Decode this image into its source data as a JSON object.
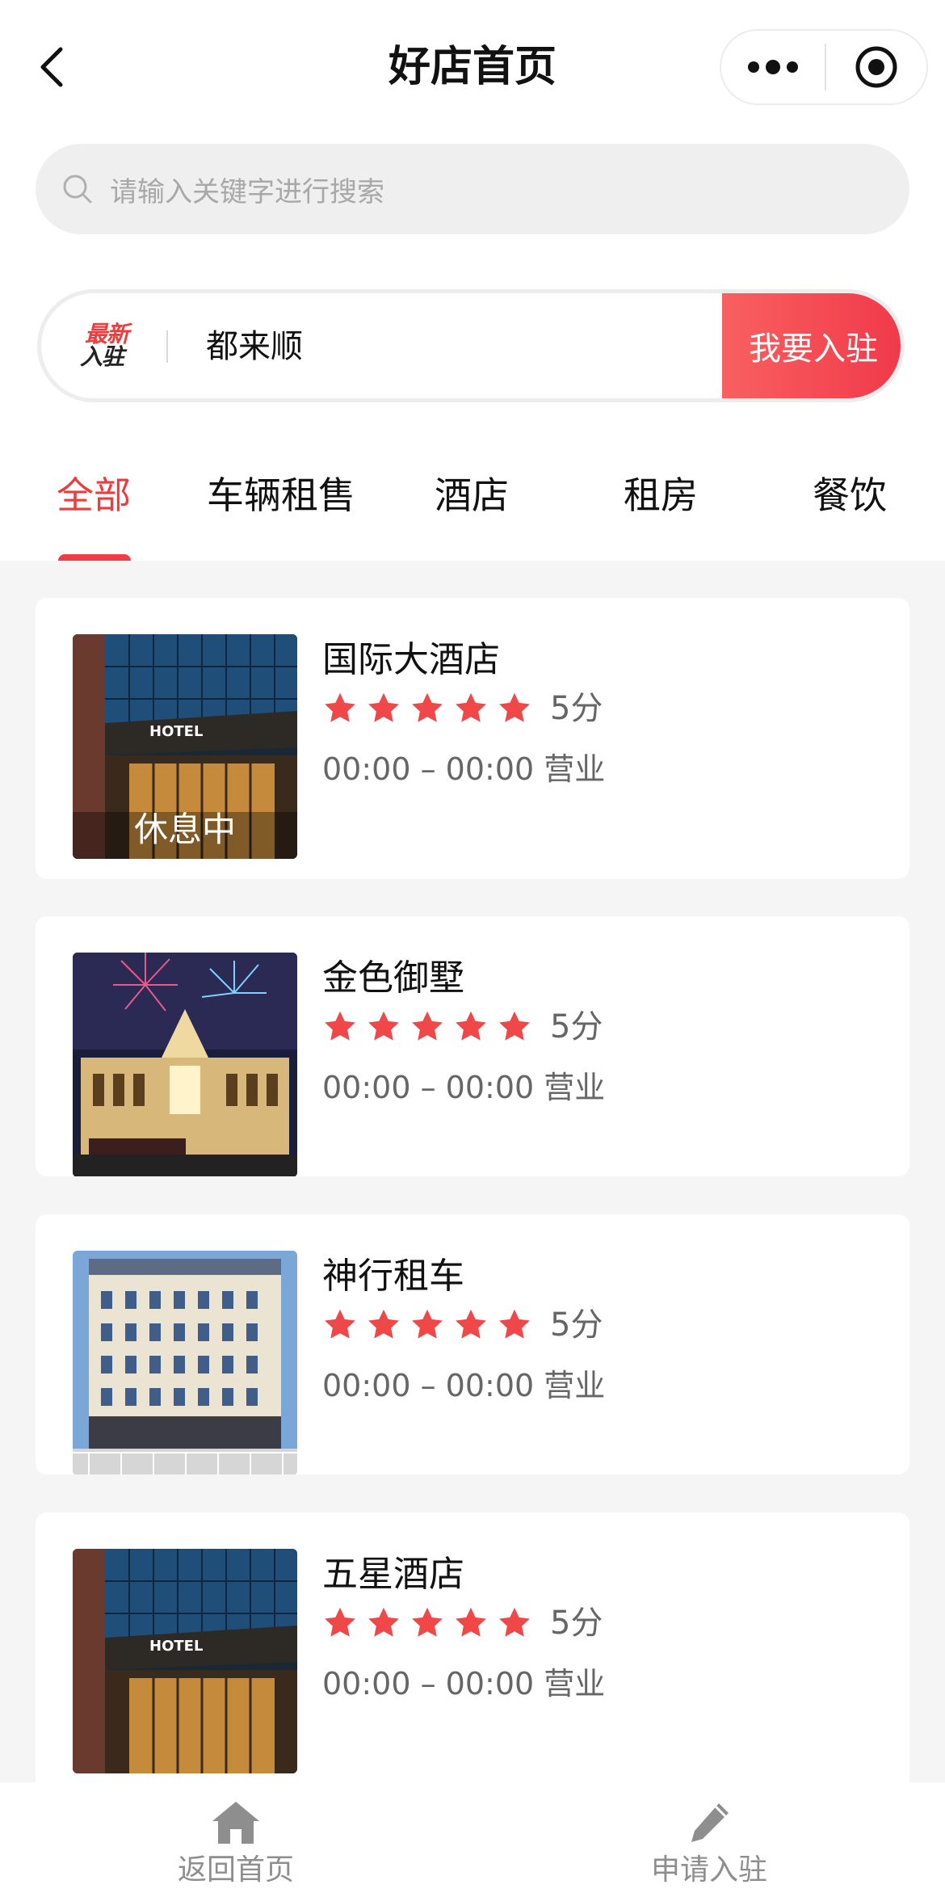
{
  "nav": {
    "title": "好店首页"
  },
  "search": {
    "placeholder": "请输入关键字进行搜索"
  },
  "announcement": {
    "badge_line1": "最新",
    "badge_line2": "入驻",
    "text": "都来顺",
    "join_label": "我要入驻"
  },
  "tabs": [
    {
      "label": "全部",
      "active": true
    },
    {
      "label": "车辆租售",
      "active": false
    },
    {
      "label": "酒店",
      "active": false
    },
    {
      "label": "租房",
      "active": false
    },
    {
      "label": "餐饮",
      "active": false
    }
  ],
  "shops": [
    {
      "name": "国际大酒店",
      "rating": 5,
      "score_text": "5分",
      "hours": "00:00 – 00:00 营业",
      "status": "休息中",
      "image": "hotel-glass-entrance"
    },
    {
      "name": "金色御墅",
      "rating": 5,
      "score_text": "5分",
      "hours": "00:00 – 00:00 营业",
      "status": "",
      "image": "hotel-fireworks-night"
    },
    {
      "name": "神行租车",
      "rating": 5,
      "score_text": "5分",
      "hours": "00:00 – 00:00 营业",
      "status": "",
      "image": "hotel-white-facade"
    },
    {
      "name": "五星酒店",
      "rating": 5,
      "score_text": "5分",
      "hours": "00:00 – 00:00 营业",
      "status": "",
      "image": "hotel-glass-entrance"
    }
  ],
  "tabbar": [
    {
      "label": "返回首页",
      "icon": "home-icon"
    },
    {
      "label": "申请入驻",
      "icon": "pencil-icon"
    }
  ],
  "colors": {
    "accent": "#ee3b3b",
    "star": "#f04848"
  }
}
